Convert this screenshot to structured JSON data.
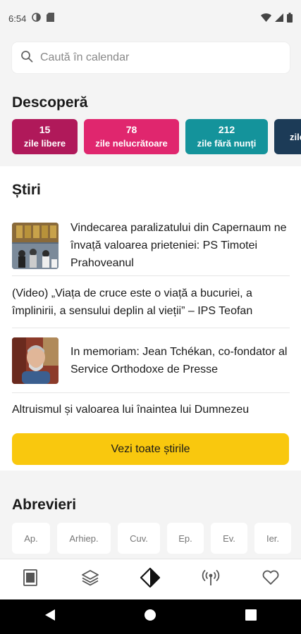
{
  "status_bar": {
    "time": "6:54",
    "left_icons": [
      "vpn-icon",
      "sd-card-icon"
    ],
    "right_icons": [
      "wifi-icon",
      "signal-icon",
      "battery-icon"
    ]
  },
  "search": {
    "placeholder": "Caută în calendar",
    "icon": "search-icon"
  },
  "discover": {
    "title": "Descoperă",
    "cards": [
      {
        "number": "15",
        "label": "zile libere",
        "color": "#b0195a"
      },
      {
        "number": "78",
        "label": "zile nelucrătoare",
        "color": "#e0266e"
      },
      {
        "number": "212",
        "label": "zile fără nunți",
        "color": "#14939b"
      },
      {
        "number": "",
        "label": "zile",
        "color": "#1c3b57"
      }
    ]
  },
  "news": {
    "title": "Știri",
    "items": [
      {
        "text": "Vindecarea paralizatului din Capernaum ne învață valoarea prieteniei: PS Timotei Prahoveanul",
        "thumbnail": "church-gathering-photo"
      },
      {
        "text": "(Video) „Viața de cruce este o viață a bucuriei, a împlinirii, a sensului deplin al vieții” – IPS Teofan",
        "thumbnail": ""
      },
      {
        "text": "In memoriam: Jean Tchékan, co-fondator al Service Orthodoxe de Presse",
        "thumbnail": "portrait-photo"
      },
      {
        "text": "Altruismul și valoarea lui înaintea lui Dumnezeu",
        "thumbnail": ""
      }
    ],
    "see_all_label": "Vezi toate știrile",
    "see_all_color": "#f9c80e"
  },
  "abbreviations": {
    "title": "Abrevieri",
    "chips": [
      "Ap.",
      "Arhiep.",
      "Cuv.",
      "Ep.",
      "Ev.",
      "Ier."
    ]
  },
  "bottom_nav": {
    "items": [
      "calendar-icon",
      "layers-icon",
      "compass-icon",
      "broadcast-icon",
      "heart-icon"
    ]
  },
  "system_nav": [
    "back-icon",
    "home-icon",
    "recents-icon"
  ]
}
